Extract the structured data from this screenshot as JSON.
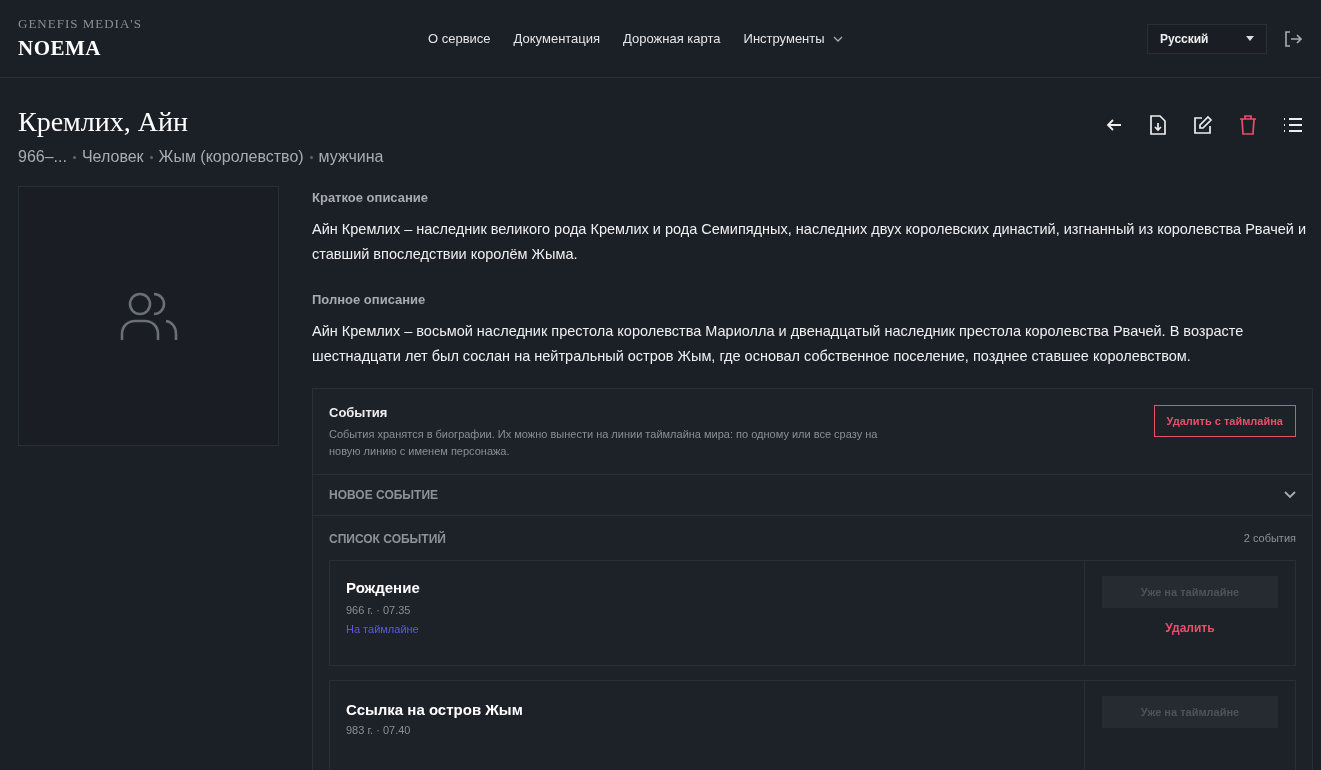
{
  "logo": {
    "over": "GENEFIS MEDIA'S",
    "name": "NOEMA"
  },
  "nav": [
    {
      "label": "О сервисе",
      "dropdown": false
    },
    {
      "label": "Документация",
      "dropdown": false
    },
    {
      "label": "Дорожная карта",
      "dropdown": false
    },
    {
      "label": "Инструменты",
      "dropdown": true
    }
  ],
  "language": "Русский",
  "title": "Кремлих, Айн",
  "meta": [
    "966–...",
    "Человек",
    "Жым (королевство)",
    "мужчина"
  ],
  "sections": [
    {
      "heading": "Краткое описание",
      "text": "Айн Кремлих – наследник великого рода Кремлих и рода Семипядных, наследних двух королевских династий, изгнанный из королевства Рвачей и ставший впоследствии королём Жыма."
    },
    {
      "heading": "Полное описание",
      "text": "Айн Кремлих – восьмой наследник престола королевства Мариолла и двенадцатый наследник престола королевства Рвачей. В возрасте шестнадцати лет был сослан на нейтральный остров Жым, где основал собственное поселение, позднее ставшее королевством."
    }
  ],
  "events": {
    "title": "События",
    "description": "События хранятся в биографии. Их можно вынести на линии таймлайна мира: по одному или все сразу на новую линию с именем персонажа.",
    "remove_button": "Удалить с таймлайна",
    "new_event": {
      "label": "НОВОЕ СОБЫТИЕ",
      "expanded": false
    },
    "list_label": "СПИСОК СОБЫТИЙ",
    "count": "2 события",
    "items": [
      {
        "title": "Рождение",
        "date": "966 г. · 07.35",
        "status": "На таймлайне",
        "button": "Уже на таймлайне",
        "delete": "Удалить"
      },
      {
        "title": "Ссылка на остров Жым",
        "date": "983 г. · 07.40",
        "button": "Уже на таймлайне"
      }
    ]
  }
}
